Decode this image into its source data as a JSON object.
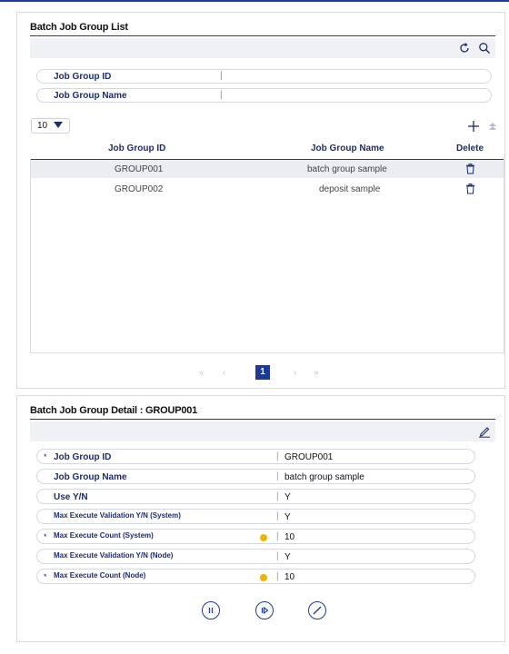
{
  "list_panel": {
    "title": "Batch Job Group List",
    "search": {
      "fields": [
        {
          "label": "Job Group ID",
          "value": ""
        },
        {
          "label": "Job Group Name",
          "value": ""
        }
      ],
      "separator": "|"
    },
    "page_size": "10",
    "grid": {
      "headers": [
        "Job Group ID",
        "Job Group Name",
        "Delete"
      ],
      "rows": [
        {
          "id": "GROUP001",
          "name": "batch group sample",
          "selected": true
        },
        {
          "id": "GROUP002",
          "name": "deposit sample",
          "selected": false
        }
      ]
    },
    "pager": {
      "first": "«",
      "prev": "‹",
      "current": "1",
      "next": "›",
      "last": "»"
    }
  },
  "detail_panel": {
    "title": "Batch Job Group Detail : GROUP001",
    "fields": [
      {
        "label": "Job Group ID",
        "value": "GROUP001",
        "required": true,
        "help": false
      },
      {
        "label": "Job Group Name",
        "value": "batch group sample",
        "required": false,
        "help": false
      },
      {
        "label": "Use Y/N",
        "value": "Y",
        "required": false,
        "help": false
      },
      {
        "label": "Max Execute Validation Y/N (System)",
        "value": "Y",
        "required": false,
        "help": false
      },
      {
        "label": "Max Execute Count (System)",
        "value": "10",
        "required": true,
        "help": true
      },
      {
        "label": "Max Execute Validation Y/N (Node)",
        "value": "Y",
        "required": false,
        "help": false
      },
      {
        "label": "Max Execute Count (Node)",
        "value": "10",
        "required": true,
        "help": true
      }
    ],
    "required_mark": "*",
    "separator": "|"
  },
  "icons": {
    "refresh": "refresh-icon",
    "search": "search-icon",
    "add": "plus-icon",
    "top": "scroll-top-icon",
    "delete": "trash-icon",
    "edit": "pencil-icon",
    "pause": "pause-circle-icon",
    "resume": "resume-circle-icon",
    "stop": "stop-circle-icon"
  },
  "colors": {
    "accent": "#1f3a93",
    "label": "#1d2c6b",
    "help": "#f0b400",
    "selected_row": "#ebedf2"
  }
}
